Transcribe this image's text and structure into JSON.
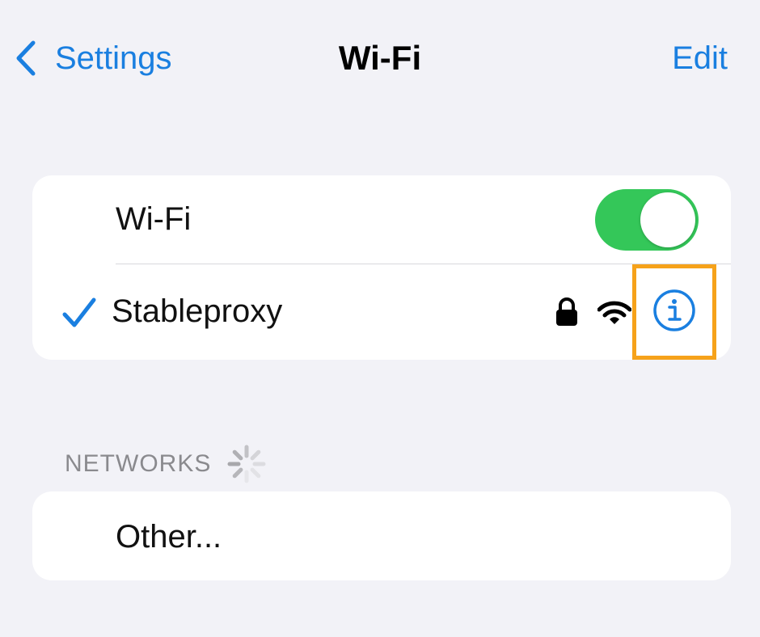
{
  "nav": {
    "back_label": "Settings",
    "title": "Wi-Fi",
    "edit_label": "Edit"
  },
  "wifi_group": {
    "toggle_label": "Wi-Fi",
    "toggle_on": true,
    "connected_network": "Stableproxy"
  },
  "networks": {
    "header": "NETWORKS",
    "items": [
      {
        "label": "Other..."
      }
    ]
  },
  "icons": {
    "back": "chevron-left-icon",
    "check": "checkmark-icon",
    "lock": "lock-icon",
    "signal": "wifi-signal-icon",
    "info": "info-icon",
    "loading": "spinner-icon"
  },
  "colors": {
    "accent": "#1a7fe0",
    "toggle_on": "#34c759",
    "highlight": "#f6a21a",
    "background": "#f2f2f7"
  }
}
